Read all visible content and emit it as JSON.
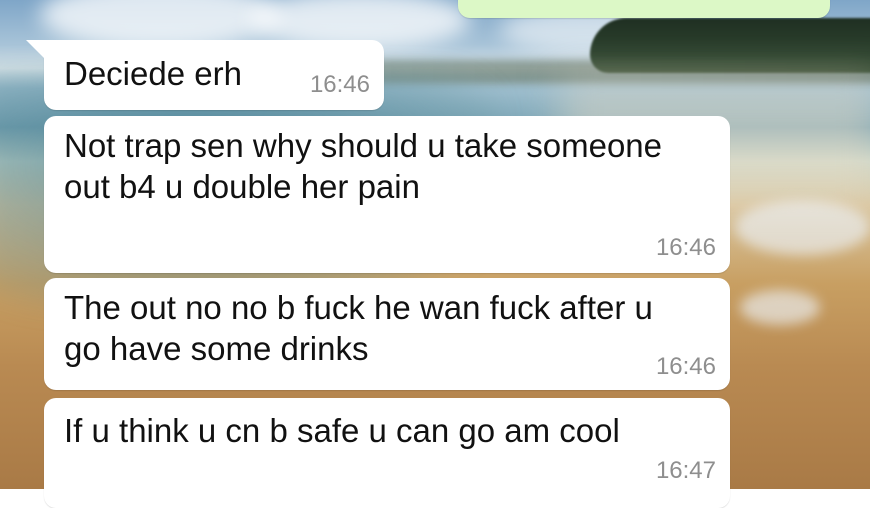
{
  "chat": {
    "messages": [
      {
        "direction": "incoming",
        "text": "Deciede erh",
        "time": "16:46"
      },
      {
        "direction": "incoming",
        "text": "Not trap sen why should u take someone out b4 u double her pain",
        "time": "16:46"
      },
      {
        "direction": "incoming",
        "text": "The out no no b fuck he wan fuck after u go have some drinks",
        "time": "16:46"
      },
      {
        "direction": "incoming",
        "text": "If u think u cn b safe u can go am cool",
        "time": "16:47"
      }
    ]
  },
  "colors": {
    "incoming_bubble": "#ffffff",
    "outgoing_bubble": "#dcf8c6",
    "timestamp": "#8e8e8e",
    "message_text": "#111111"
  }
}
